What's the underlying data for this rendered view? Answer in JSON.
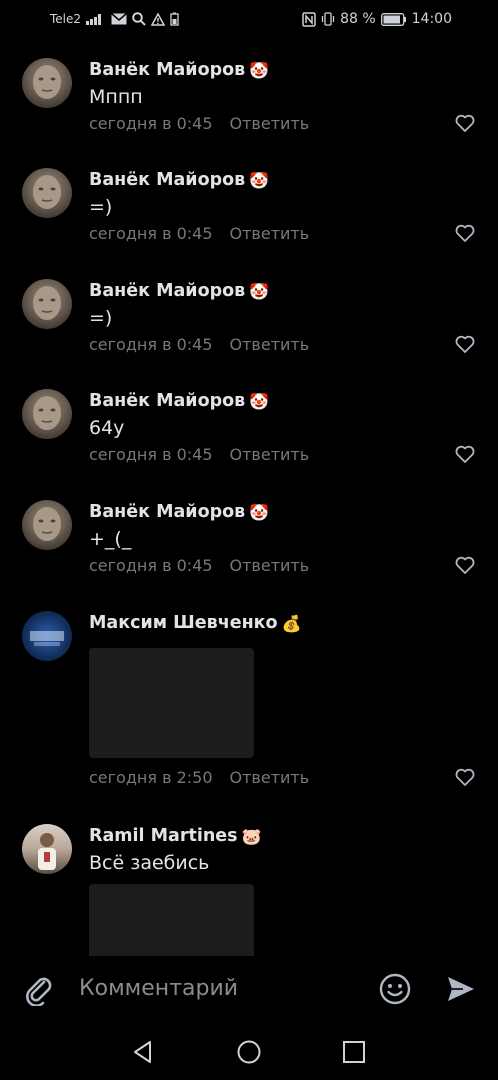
{
  "status_bar": {
    "carrier": "Tele2",
    "battery_percent": "88 %",
    "time": "14:00"
  },
  "comments": [
    {
      "author": "Ванёк Майоров",
      "badge_emoji": "🤡",
      "text": "Мппп",
      "time": "сегодня в 0:45",
      "reply_label": "Ответить"
    },
    {
      "author": "Ванёк Майоров",
      "badge_emoji": "🤡",
      "text": "=)",
      "time": "сегодня в 0:45",
      "reply_label": "Ответить"
    },
    {
      "author": "Ванёк Майоров",
      "badge_emoji": "🤡",
      "text": "=)",
      "time": "сегодня в 0:45",
      "reply_label": "Ответить"
    },
    {
      "author": "Ванёк Майоров",
      "badge_emoji": "🤡",
      "text": "64у",
      "time": "сегодня в 0:45",
      "reply_label": "Ответить"
    },
    {
      "author": "Ванёк Майоров",
      "badge_emoji": "🤡",
      "text": "+_(_",
      "time": "сегодня в 0:45",
      "reply_label": "Ответить"
    },
    {
      "author": "Максим Шевченко",
      "badge_emoji": "💰",
      "text": "",
      "time": "сегодня в 2:50",
      "reply_label": "Ответить"
    },
    {
      "author": "Ramil Martines",
      "badge_emoji": "🐷",
      "text": "Всё заебись",
      "time": "",
      "reply_label": ""
    }
  ],
  "composer": {
    "placeholder": "Комментарий"
  },
  "colors": {
    "background": "#000000",
    "text_primary": "#e1e3e6",
    "text_secondary": "#76787a",
    "icon": "#aeb7c2",
    "media_placeholder": "#1c1c1c"
  },
  "icons": {
    "attach": "paperclip-icon",
    "emoji": "smile-icon",
    "send": "send-icon",
    "like": "heart-outline-icon",
    "nav_back": "triangle-back-icon",
    "nav_home": "circle-home-icon",
    "nav_recents": "square-recents-icon"
  }
}
